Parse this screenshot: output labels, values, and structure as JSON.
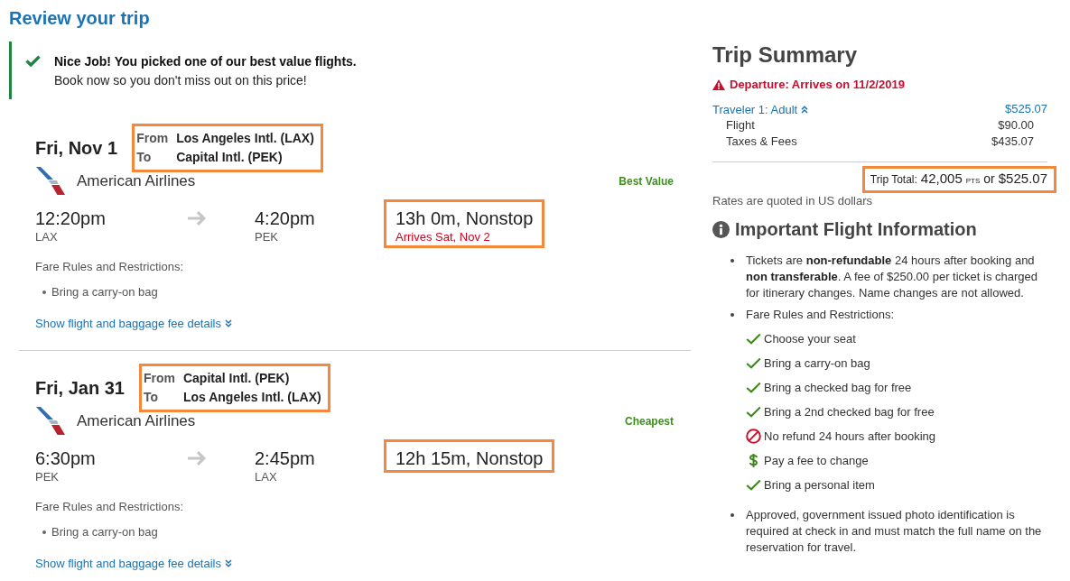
{
  "page_title": "Review your trip",
  "notice": {
    "headline": "Nice Job! You picked one of our best value flights.",
    "message": "Book now so you don't miss out on this price!"
  },
  "flights": [
    {
      "date": "Fri, Nov 1",
      "route": {
        "highlighted": true,
        "rows": [
          {
            "label": "From",
            "value": "Los Angeles Intl. (LAX)"
          },
          {
            "label": "To",
            "value": "Capital Intl. (PEK)"
          }
        ]
      },
      "airline": "American Airlines",
      "badge": "Best Value",
      "departure": {
        "time": "12:20pm",
        "airport": "LAX"
      },
      "arrival": {
        "time": "4:20pm",
        "airport": "PEK"
      },
      "duration": {
        "highlighted": true,
        "text": "13h 0m, Nonstop",
        "note": "Arrives Sat, Nov 2"
      },
      "fare_rules_label": "Fare Rules and Restrictions:",
      "fare_rules": [
        "Bring a carry-on bag"
      ],
      "details_link": {
        "text": "Show flight and baggage fee details",
        "expanded": false
      }
    },
    {
      "date": "Fri, Jan 31",
      "route": {
        "highlighted": true,
        "rows": [
          {
            "label": "From",
            "value": "Capital Intl. (PEK)"
          },
          {
            "label": "To",
            "value": "Los Angeles Intl. (LAX)"
          }
        ]
      },
      "airline": "American Airlines",
      "badge": "Cheapest",
      "departure": {
        "time": "6:30pm",
        "airport": "PEK"
      },
      "arrival": {
        "time": "2:45pm",
        "airport": "LAX"
      },
      "duration": {
        "highlighted": true,
        "text": "12h 15m, Nonstop"
      },
      "fare_rules_label": "Fare Rules and Restrictions:",
      "fare_rules": [
        "Bring a carry-on bag"
      ],
      "details_link": {
        "text": "Show flight and baggage fee details",
        "expanded": false
      }
    }
  ],
  "summary": {
    "title": "Trip Summary",
    "alert": "Departure: Arrives on 11/2/2019",
    "traveler": {
      "label": "Traveler 1: Adult",
      "amount": "$525.07",
      "expanded": true
    },
    "lines": [
      {
        "label": "Flight",
        "amount": "$90.00"
      },
      {
        "label": "Taxes & Fees",
        "amount": "$435.07"
      }
    ],
    "total": {
      "highlighted": true,
      "label": "Trip Total:",
      "points": "42,005",
      "points_unit": "PTS",
      "connector": "or",
      "price": "$525.07"
    },
    "note": "Rates are quoted in US dollars"
  },
  "important_info": {
    "title": "Important Flight Information",
    "items": [
      {
        "kind": "text",
        "text": "Tickets are **non-refundable** 24 hours after booking and **non transferable**. A fee of $250.00 per ticket is charged for itinerary changes. Name changes are not allowed."
      },
      {
        "kind": "rules",
        "text": "Fare Rules and Restrictions:",
        "rules": [
          {
            "kind": "included",
            "text": "Choose your seat"
          },
          {
            "kind": "included",
            "text": "Bring a carry-on bag"
          },
          {
            "kind": "included",
            "text": "Bring a checked bag for free"
          },
          {
            "kind": "included",
            "text": "Bring a 2nd checked bag for free"
          },
          {
            "kind": "not_allowed",
            "text": "No refund 24 hours after booking"
          },
          {
            "kind": "fee",
            "text": "Pay a fee to change"
          },
          {
            "kind": "included",
            "text": "Bring a personal item"
          }
        ]
      },
      {
        "kind": "text",
        "text": "Approved, government issued photo identification is required at check in and must match the full name on the reservation for travel."
      }
    ]
  }
}
